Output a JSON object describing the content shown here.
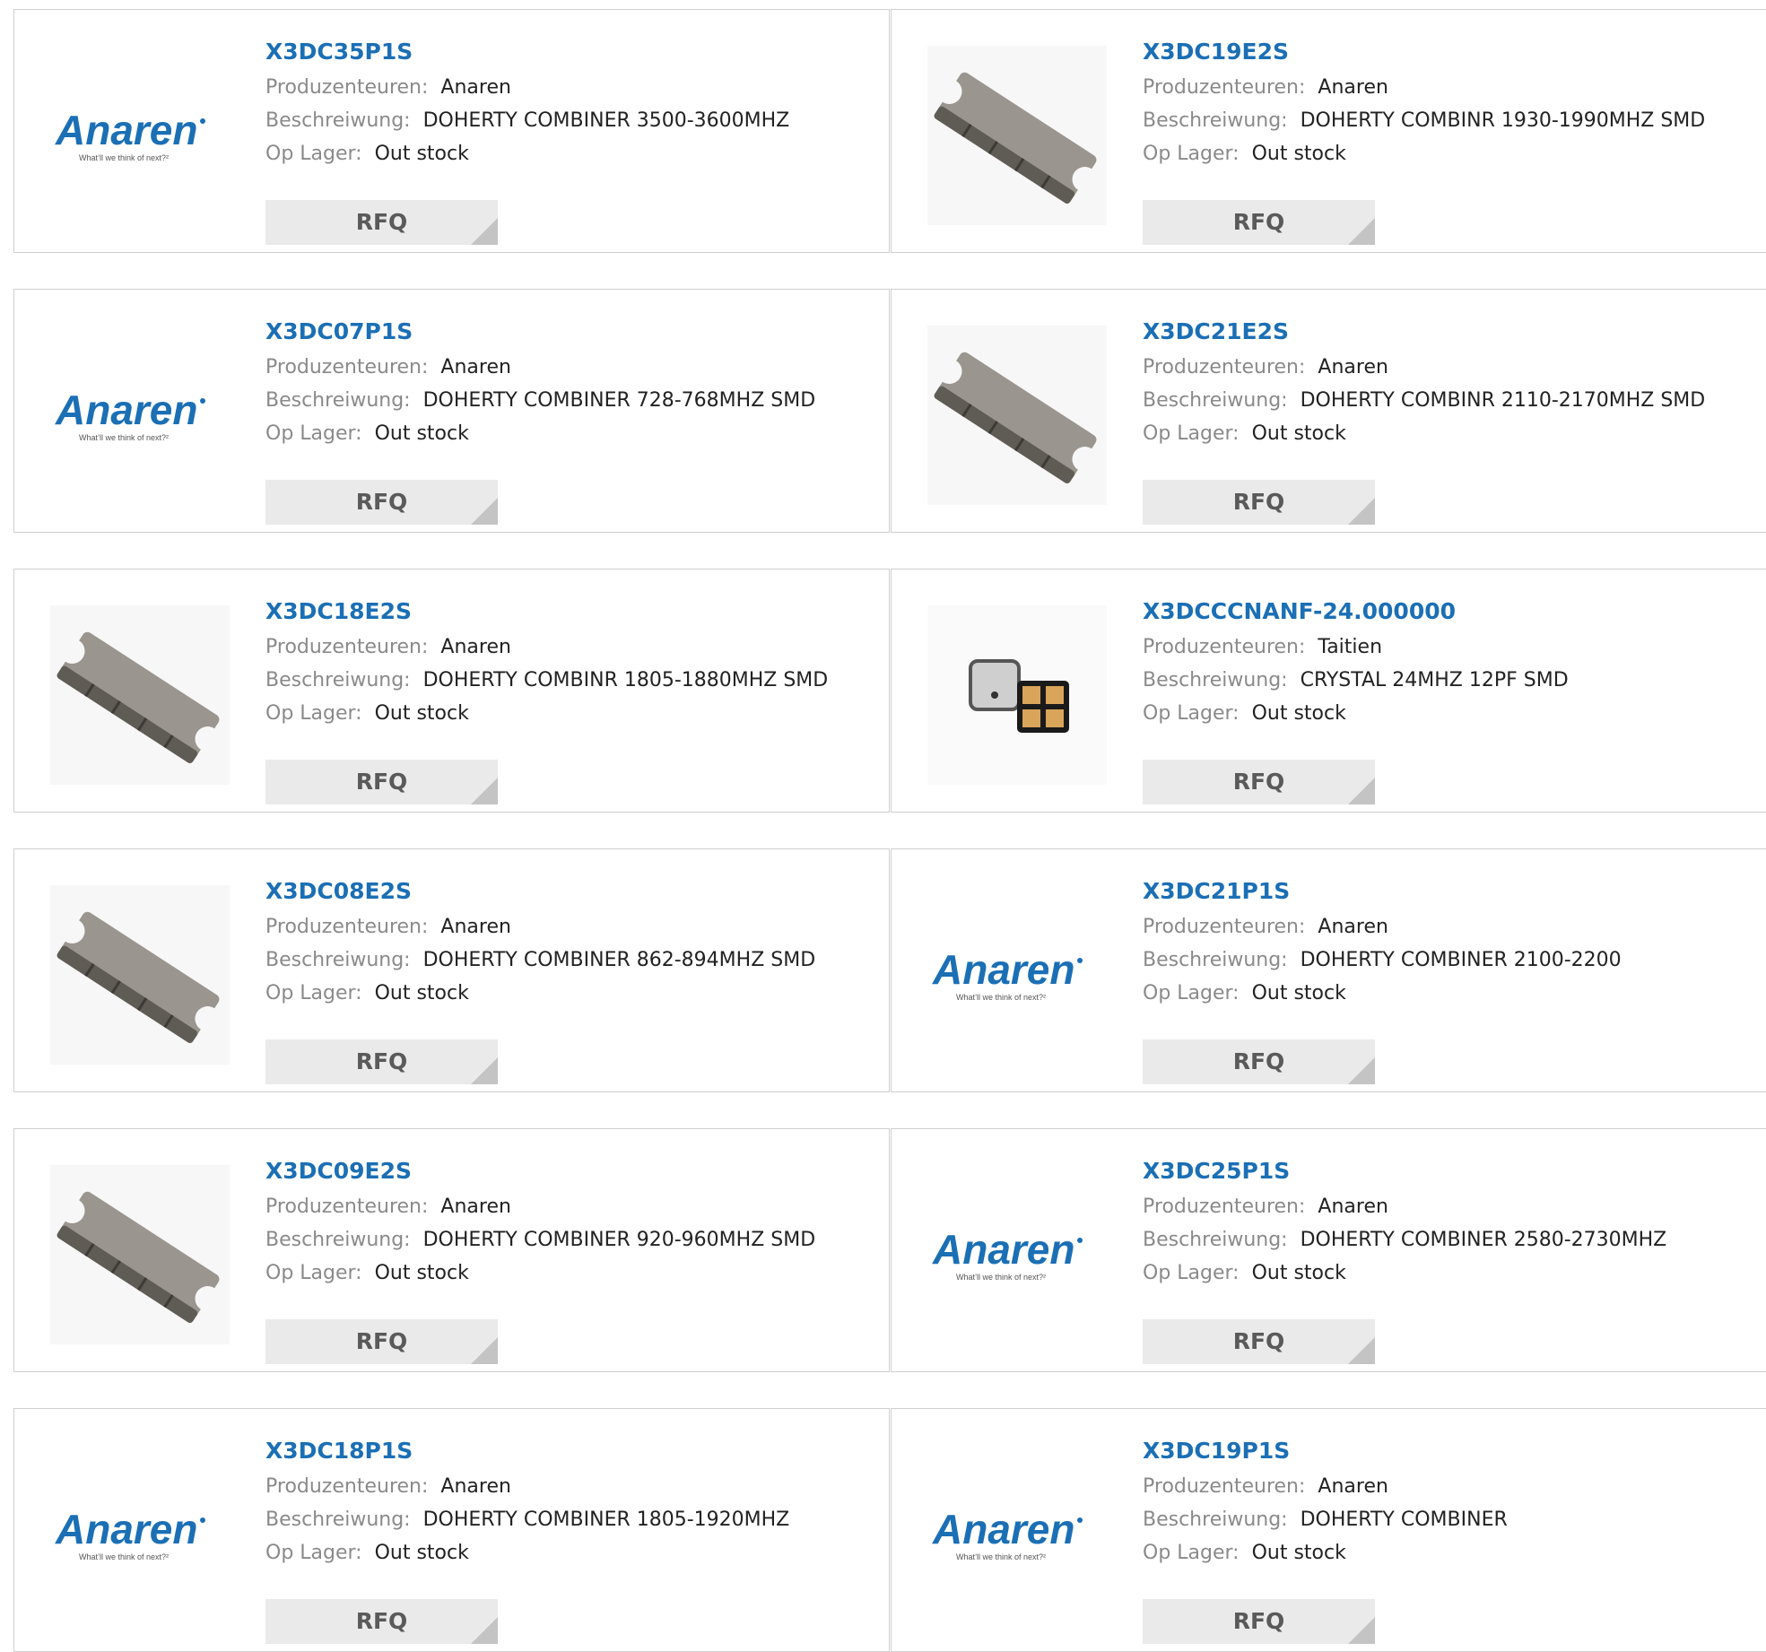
{
  "labels": {
    "manufacturer": "Produzenteuren:",
    "description": "Beschreiwung:",
    "stock": "Op Lager:",
    "rfq": "RFQ"
  },
  "brand_logo": {
    "name": "Anaren",
    "tagline": "What'll we think of next?",
    "color": "#1b6fb5"
  },
  "products": [
    {
      "part": "X3DC35P1S",
      "manufacturer": "Anaren",
      "description": "DOHERTY COMBINER 3500-3600MHZ",
      "stock": "Out stock",
      "image": "anaren-logo"
    },
    {
      "part": "X3DC19E2S",
      "manufacturer": "Anaren",
      "description": "DOHERTY COMBINR 1930-1990MHZ SMD",
      "stock": "Out stock",
      "image": "combiner-chip"
    },
    {
      "part": "X3DC07P1S",
      "manufacturer": "Anaren",
      "description": "DOHERTY COMBINER 728-768MHZ SMD",
      "stock": "Out stock",
      "image": "anaren-logo"
    },
    {
      "part": "X3DC21E2S",
      "manufacturer": "Anaren",
      "description": "DOHERTY COMBINR 2110-2170MHZ SMD",
      "stock": "Out stock",
      "image": "combiner-chip"
    },
    {
      "part": "X3DC18E2S",
      "manufacturer": "Anaren",
      "description": "DOHERTY COMBINR 1805-1880MHZ SMD",
      "stock": "Out stock",
      "image": "combiner-chip"
    },
    {
      "part": "X3DCCCNANF-24.000000",
      "manufacturer": "Taitien",
      "description": "CRYSTAL 24MHZ 12PF SMD",
      "stock": "Out stock",
      "image": "crystal"
    },
    {
      "part": "X3DC08E2S",
      "manufacturer": "Anaren",
      "description": "DOHERTY COMBINER 862-894MHZ SMD",
      "stock": "Out stock",
      "image": "combiner-chip"
    },
    {
      "part": "X3DC21P1S",
      "manufacturer": "Anaren",
      "description": "DOHERTY COMBINER 2100-2200",
      "stock": "Out stock",
      "image": "anaren-logo"
    },
    {
      "part": "X3DC09E2S",
      "manufacturer": "Anaren",
      "description": "DOHERTY COMBINER 920-960MHZ SMD",
      "stock": "Out stock",
      "image": "combiner-chip"
    },
    {
      "part": "X3DC25P1S",
      "manufacturer": "Anaren",
      "description": "DOHERTY COMBINER 2580-2730MHZ",
      "stock": "Out stock",
      "image": "anaren-logo"
    },
    {
      "part": "X3DC18P1S",
      "manufacturer": "Anaren",
      "description": "DOHERTY COMBINER 1805-1920MHZ",
      "stock": "Out stock",
      "image": "anaren-logo"
    },
    {
      "part": "X3DC19P1S",
      "manufacturer": "Anaren",
      "description": "DOHERTY COMBINER",
      "stock": "Out stock",
      "image": "anaren-logo"
    }
  ]
}
